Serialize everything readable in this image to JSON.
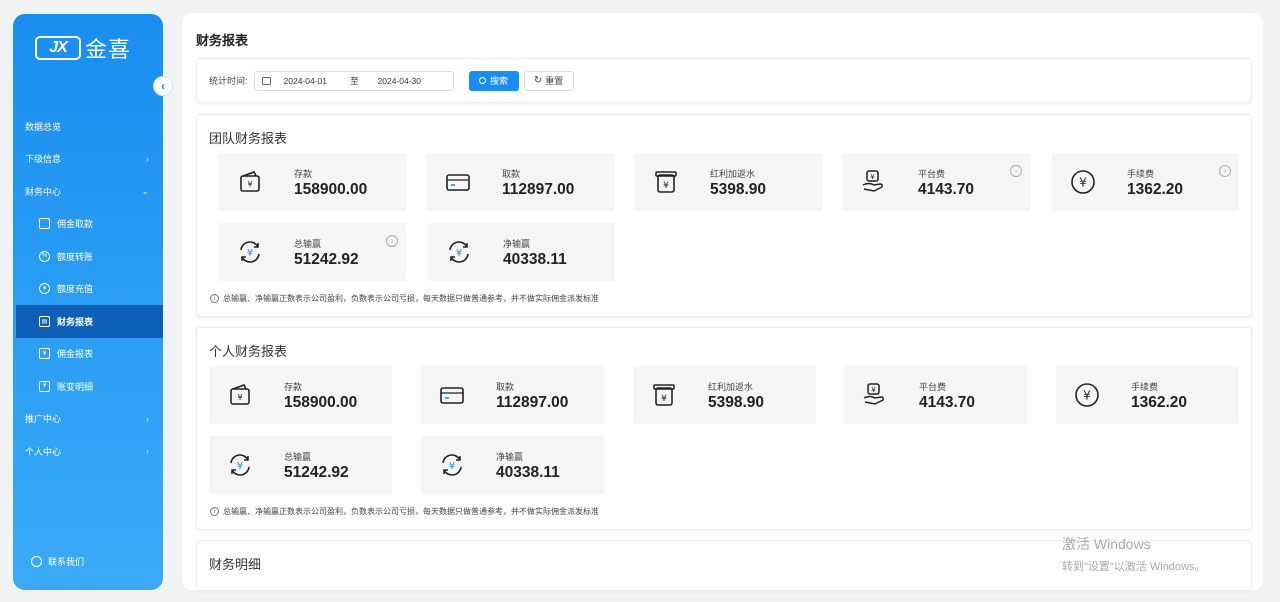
{
  "brand": {
    "badge": "JX",
    "name": "金喜"
  },
  "sidebar": {
    "items": [
      {
        "label": "数据总览",
        "has_chevron": false
      },
      {
        "label": "下级信息",
        "has_chevron": true,
        "chevron": "›"
      },
      {
        "label": "财务中心",
        "has_chevron": true,
        "chevron": "⌄"
      },
      {
        "label": "佣金取款",
        "sub": true,
        "icon": "card-icon"
      },
      {
        "label": "额度转账",
        "sub": true,
        "icon": "transfer-icon"
      },
      {
        "label": "额度充值",
        "sub": true,
        "icon": "yuan-circle-icon"
      },
      {
        "label": "财务报表",
        "sub": true,
        "icon": "report-icon",
        "active": true
      },
      {
        "label": "佣金报表",
        "sub": true,
        "icon": "commission-report-icon"
      },
      {
        "label": "账变明细",
        "sub": true,
        "icon": "ledger-icon"
      },
      {
        "label": "推广中心",
        "has_chevron": true,
        "chevron": "›"
      },
      {
        "label": "个人中心",
        "has_chevron": true,
        "chevron": "›"
      }
    ],
    "contact_label": "联系我们"
  },
  "page": {
    "title": "财务报表"
  },
  "filter": {
    "label": "统计时间:",
    "start_date": "2024-04-01",
    "separator": "至",
    "end_date": "2024-04-30",
    "search_label": "搜索",
    "reset_label": "重置"
  },
  "team": {
    "title": "团队财务报表",
    "cards": [
      {
        "label": "存款",
        "value": "158900.00",
        "icon": "wallet-icon"
      },
      {
        "label": "取款",
        "value": "112897.00",
        "icon": "card-icon"
      },
      {
        "label": "红利加返水",
        "value": "5398.90",
        "icon": "yuan-box-icon"
      },
      {
        "label": "平台费",
        "value": "4143.70",
        "icon": "hand-yuan-icon",
        "help": true
      },
      {
        "label": "手续费",
        "value": "1362.20",
        "icon": "yuan-circle-icon",
        "help": true
      },
      {
        "label": "总输赢",
        "value": "51242.92",
        "icon": "yuan-cycle-icon",
        "help": true
      },
      {
        "label": "净输赢",
        "value": "40338.11",
        "icon": "yuan-cycle-icon"
      }
    ],
    "note": "总输赢、净输赢正数表示公司盈利，负数表示公司亏损，每天数据只做普通参考，并不做实际佣金派发标准"
  },
  "personal": {
    "title": "个人财务报表",
    "cards": [
      {
        "label": "存款",
        "value": "158900.00",
        "icon": "wallet-icon"
      },
      {
        "label": "取款",
        "value": "112897.00",
        "icon": "card-icon"
      },
      {
        "label": "红利加返水",
        "value": "5398.90",
        "icon": "yuan-box-icon"
      },
      {
        "label": "平台费",
        "value": "4143.70",
        "icon": "hand-yuan-icon"
      },
      {
        "label": "手续费",
        "value": "1362.20",
        "icon": "yuan-circle-icon"
      },
      {
        "label": "总输赢",
        "value": "51242.92",
        "icon": "yuan-cycle-icon"
      },
      {
        "label": "净输赢",
        "value": "40338.11",
        "icon": "yuan-cycle-icon"
      }
    ],
    "note": "总输赢、净输赢正数表示公司盈利，负数表示公司亏损，每天数据只做普通参考，并不做实际佣金派发标准"
  },
  "details": {
    "title": "财务明细"
  },
  "watermark": {
    "line1": "激活 Windows",
    "line2": "转到\"设置\"以激活 Windows。"
  },
  "colors": {
    "primary": "#1a8ef0",
    "active_menu": "#0d5fb8",
    "card_bg": "#f5f5f5"
  }
}
